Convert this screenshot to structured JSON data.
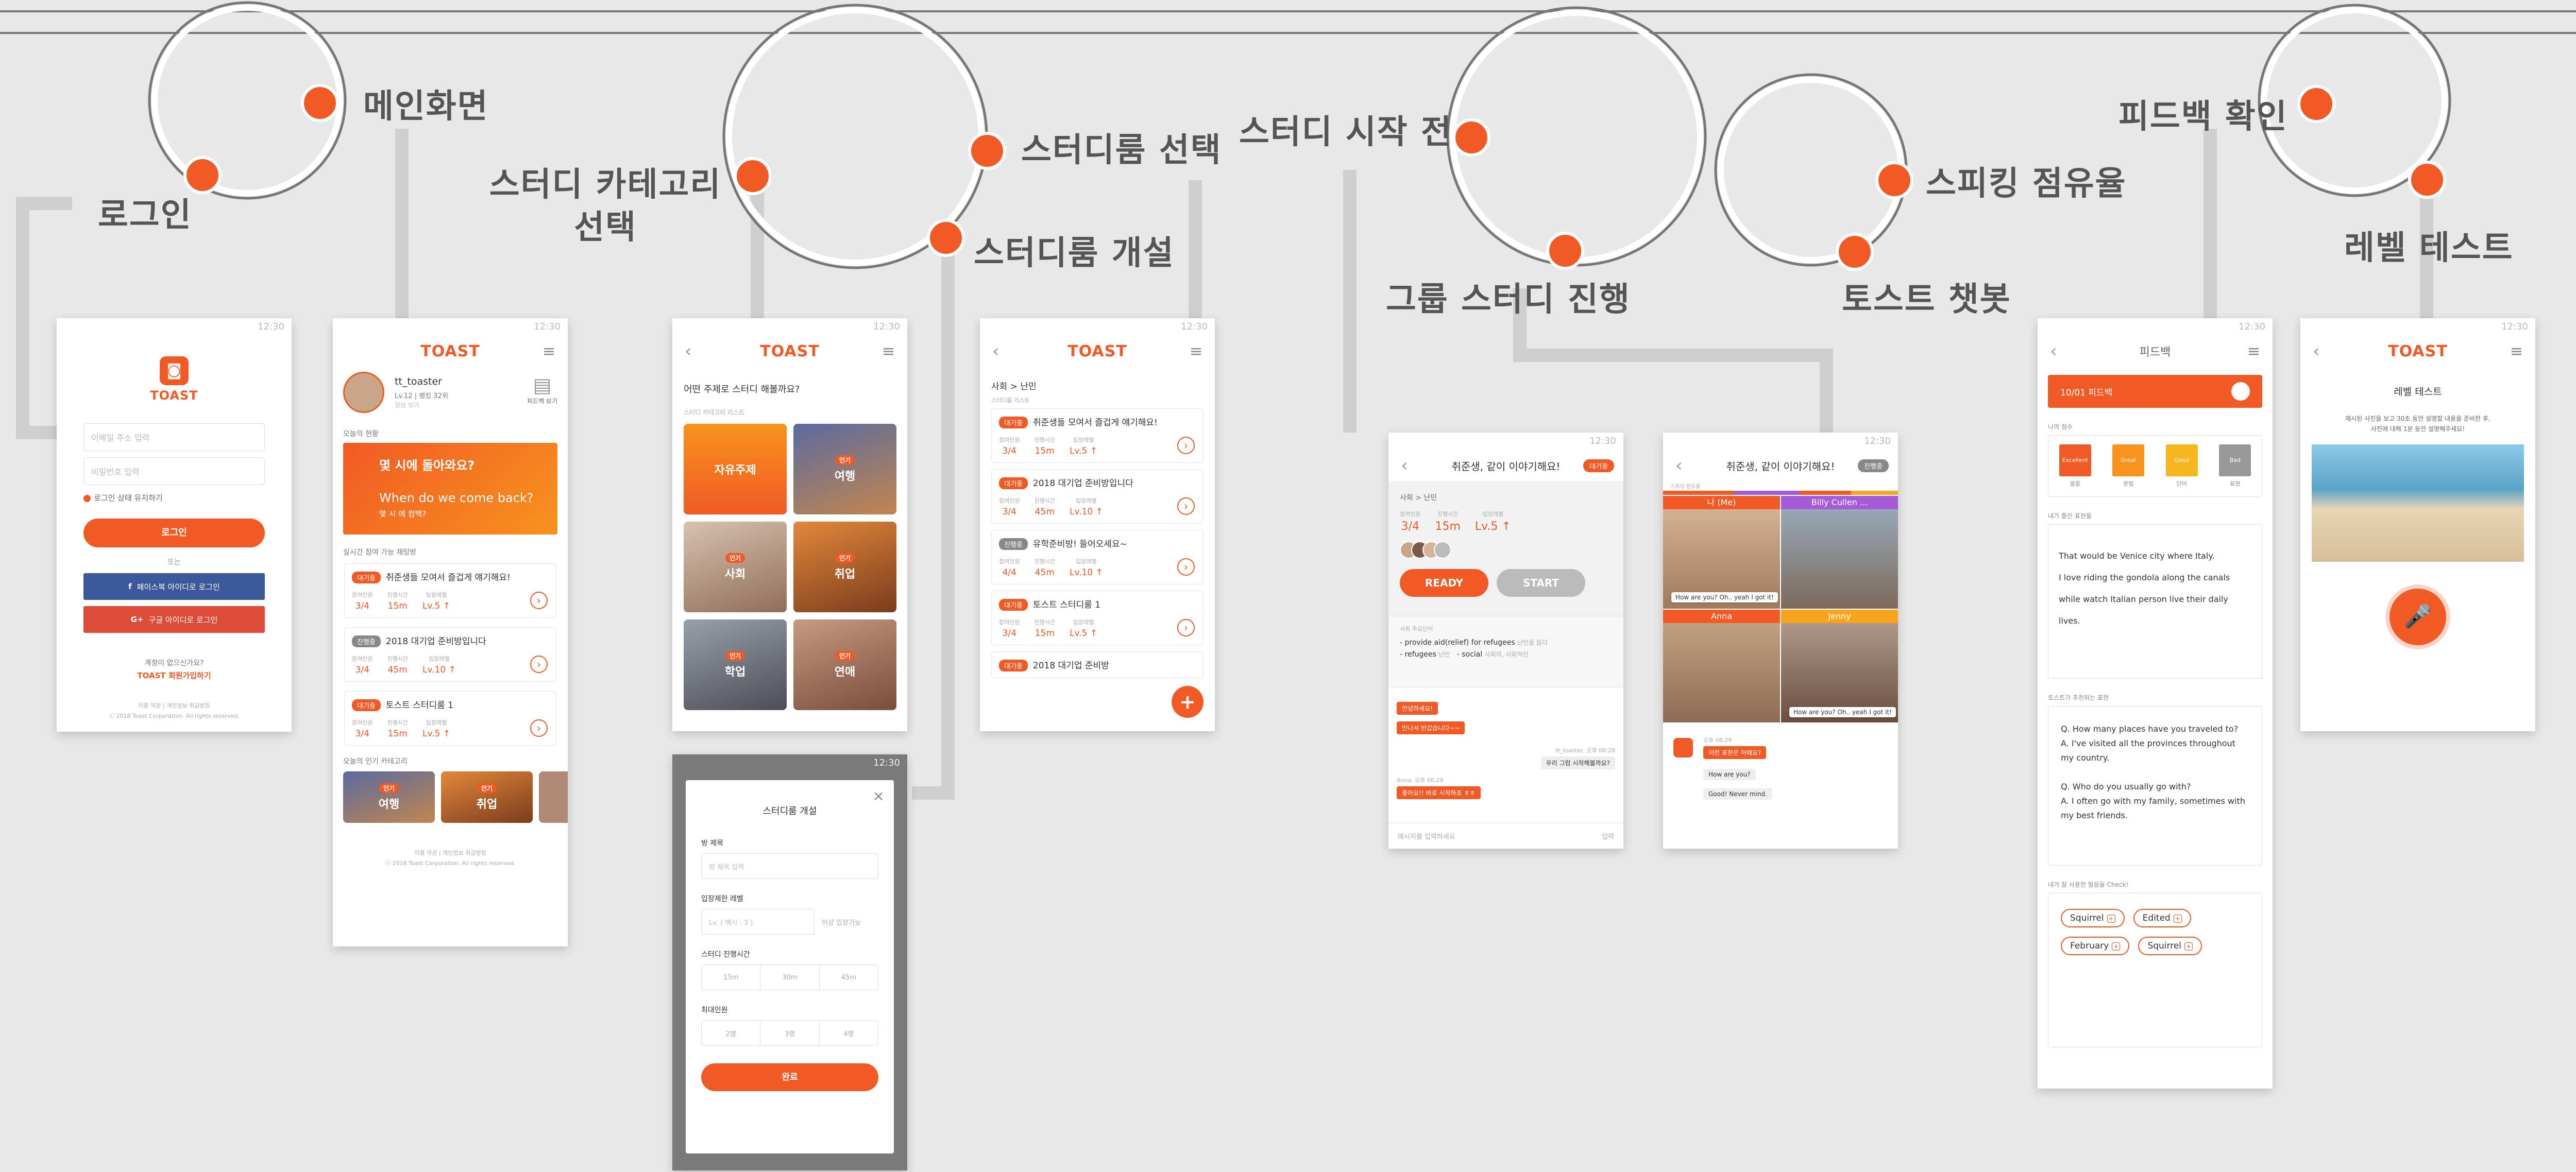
{
  "labels": {
    "login": "로그인",
    "main": "메인화면",
    "category_line1": "스터디 카테고리",
    "category_line2": "선택",
    "room_select": "스터디룸 선택",
    "room_create": "스터디룸 개설",
    "before_start": "스터디 시작 전",
    "group_study": "그룹 스터디 진행",
    "speaking_share": "스피킹 점유율",
    "toast_chatbot": "토스트 챗봇",
    "feedback_check": "피드백 확인",
    "level_test": "레벨 테스트"
  },
  "status_time": "12:30",
  "brand": {
    "logo": "TOAST",
    "color": "#f15a24"
  },
  "login": {
    "email_placeholder": "이메일 주소 입력",
    "password_placeholder": "비밀번호 입력",
    "keep_logged_in": "로그인 상태 유지하기",
    "login_button": "로그인",
    "or": "또는",
    "facebook_login": "페이스북 아이디로 로그인",
    "google_login": "구글 아이디로 로그인",
    "no_account": "계정이 없으신가요?",
    "signup": "TOAST 회원가입하기",
    "terms": "이용 약관  |  개인정보 취급방침",
    "copyright": "ⓒ 2018 Toast Corporation. All rights reserved."
  },
  "main": {
    "username": "tt_toaster",
    "user_sub": "Lv.12 | 랭킹 32위",
    "user_sub2": "정보 보기",
    "feedback_link": "피드백 보기",
    "today_status": "오늘의 현황",
    "banner_kr": "몇 시에 돌아와요?",
    "banner_en": "When do we come back?",
    "banner_hint": "몇 시 에 컴백?",
    "live_rooms": "실시간 참여 가능 채팅방",
    "popular_categories": "오늘의 인기 카테고리",
    "terms": "이용 약관  |  개인정보 취급방침",
    "copyright": "ⓒ 2018 Toast Corporation. All rights reserved."
  },
  "stat_keys": {
    "members": "참여인원",
    "duration": "진행시간",
    "level": "입장레벨"
  },
  "rooms": [
    {
      "tag": "대기중",
      "tag_style": "o",
      "title": "취준생들 모여서 즐겁게 얘기해요!",
      "members": "3/4",
      "duration": "15m",
      "level": "Lv.5 ↑"
    },
    {
      "tag": "진행중",
      "tag_style": "g",
      "title": "2018 대기업 준비방입니다",
      "members": "3/4",
      "duration": "45m",
      "level": "Lv.10 ↑"
    },
    {
      "tag": "대기중",
      "tag_style": "o",
      "title": "토스트 스터디룸 1",
      "members": "3/4",
      "duration": "15m",
      "level": "Lv.5 ↑"
    }
  ],
  "category": {
    "question": "어떤 주제로 스터디 해볼까요?",
    "list_label": "스터디 카테고리 리스트",
    "tiles": [
      {
        "name": "자유주제",
        "badge": ""
      },
      {
        "name": "여행",
        "badge": "인기"
      },
      {
        "name": "사회",
        "badge": "인기"
      },
      {
        "name": "취업",
        "badge": "인기"
      },
      {
        "name": "학업",
        "badge": "인기"
      },
      {
        "name": "연애",
        "badge": "인기"
      }
    ],
    "popular": [
      "여행",
      "취업"
    ]
  },
  "roomlist": {
    "breadcrumb": "사회 > 난민",
    "list_label": "스터디룸 리스트",
    "rooms": [
      {
        "tag": "대기중",
        "tag_style": "o",
        "title": "취준생들 모여서 즐겁게 얘기해요!",
        "members": "3/4",
        "duration": "15m",
        "level": "Lv.5 ↑"
      },
      {
        "tag": "대기중",
        "tag_style": "o",
        "title": "2018 대기업 준비방입니다",
        "members": "3/4",
        "duration": "45m",
        "level": "Lv.10 ↑"
      },
      {
        "tag": "진행중",
        "tag_style": "g",
        "title": "유학준비방! 들어오세요~",
        "members": "4/4",
        "duration": "45m",
        "level": "Lv.10 ↑"
      },
      {
        "tag": "대기중",
        "tag_style": "o",
        "title": "토스트 스터디룸 1",
        "members": "3/4",
        "duration": "15m",
        "level": "Lv.5 ↑"
      },
      {
        "tag": "대기중",
        "tag_style": "o",
        "title": "2018 대기업 준비방",
        "members": "",
        "duration": "",
        "level": ""
      }
    ],
    "fab": "+"
  },
  "create_room": {
    "title": "스터디룸 개설",
    "room_name_label": "방 제목",
    "room_name_placeholder": "방 제목 입력",
    "level_label": "입장제한 레벨",
    "level_placeholder": "Lv. ( 예시 : 3 )",
    "level_suffix": "이상 입장가능",
    "time_label": "스터디 진행시간",
    "time_options": [
      "15m",
      "30m",
      "45m"
    ],
    "members_label": "최대인원",
    "member_options": [
      "2명",
      "3명",
      "4명"
    ],
    "submit": "완료"
  },
  "before": {
    "title": "취준생, 같이 이야기해요!",
    "status": "대기중",
    "breadcrumb": "사회 > 난민",
    "members": "3/4",
    "duration": "15m",
    "level": "Lv.5 ↑",
    "ready": "READY",
    "start": "START",
    "keywords_label": "사회 주요단어",
    "keywords": [
      {
        "en": "provide aid(relief) for refugees",
        "kr": "난민을 돕다"
      },
      {
        "en": "refugees",
        "kr": "난민"
      },
      {
        "en": "social",
        "kr": "사회의, 사회적인"
      }
    ],
    "chat": [
      {
        "text": "안녕하세요!",
        "me": false
      },
      {
        "text": "만나서 반갑습니다~~",
        "me": false
      },
      {
        "text": "우리 그럼 시작해볼까요?",
        "me": true,
        "who": "tt_toaster, 오후 06:28"
      },
      {
        "text": "좋아요!! 바로 시작하죠 ㅎㅎ",
        "me": false,
        "who": "Anna, 오후 06:29"
      }
    ],
    "input_placeholder": "메시지를 입력하세요",
    "send": "입력"
  },
  "group": {
    "title": "취준생, 같이 이야기해요!",
    "status": "진행중",
    "share_label": "스피킹 점유율",
    "participants": [
      {
        "name": "나 (Me)",
        "color": "#f15a24"
      },
      {
        "name": "Billy Cullen ...",
        "color": "#a55ad8"
      },
      {
        "name": "Anna",
        "color": "#f15a24"
      },
      {
        "name": "Jenny",
        "color": "#f7a51c"
      }
    ],
    "bubble": "How are you? Oh.. yeah I got it!",
    "bot_time": "오후 06:29",
    "bot_msgs": [
      "이런 표현은 어때요?",
      "How are you?",
      "Good! Never mind."
    ]
  },
  "feedback": {
    "title": "피드백",
    "date_bar": "10/01  피드백",
    "score_label": "나의 점수",
    "scores": [
      {
        "label": "Excellent",
        "sub": "발음",
        "color": "#f15a24"
      },
      {
        "label": "Great",
        "sub": "문법",
        "color": "#f7931e"
      },
      {
        "label": "Good",
        "sub": "단어",
        "color": "#f7b51e"
      },
      {
        "label": "Bad",
        "sub": "표현",
        "color": "#999999"
      }
    ],
    "wrong_label": "내가 틀린 표현들",
    "sentence1": "That  would be Venice city  where Italy.",
    "sentence2": "I love riding the gondola along the canals",
    "sentence3": "while watch Italian person live their daily",
    "sentence4": "lives.",
    "recommend_label": "토스트가 추천하는 표현",
    "qa": [
      {
        "q": "How many places have you traveled to?",
        "a": "I've visited all the provinces throughout my country."
      },
      {
        "q": "Who do you usually go with?",
        "a": "I often go with my family, sometimes with my best friends."
      }
    ],
    "words_label": "내가 잘 사용한 발음들 Check!",
    "words": [
      "Squirrel",
      "Edited",
      "February",
      "Squirrel"
    ]
  },
  "leveltest": {
    "title": "레벨 테스트",
    "instruction_line1": "제시된 사진을 보고 30초 동안 설명할 내용을 준비한 후,",
    "instruction_line2": "사진에 대해 1분 동안 설명해주세요!",
    "mic": "🎤"
  }
}
